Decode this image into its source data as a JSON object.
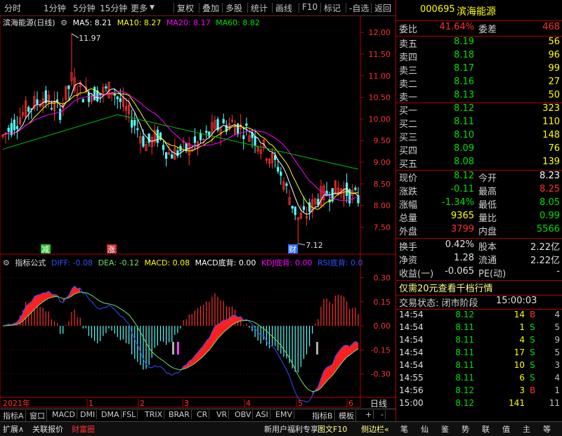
{
  "toolbar": {
    "left": [
      "分时",
      "1分钟",
      "5分钟",
      "15分钟",
      "更多"
    ],
    "right": [
      "复权",
      "叠加",
      "多股",
      "统计",
      "画线",
      "F10",
      "标记",
      "-自选",
      "返回"
    ]
  },
  "kline_header": {
    "title": "滨海能源(日线)",
    "ma5": "MA5: 8.21",
    "ma10": "MA10: 8.27",
    "ma20": "MA20: 8.17",
    "ma60": "MA60: 8.82"
  },
  "indicator_header": {
    "title": "指标公式",
    "diff": "DIFF: -0.08",
    "dea": "DEA: -0.12",
    "macd": "MACD: 0.08",
    "macd_div": "MACD底背: 0.00",
    "kdj_div": "KDJ底背: 0.00",
    "rsi_div": "RSI底背: 0.0"
  },
  "chart_labels": {
    "high_marker": "11.97",
    "low_marker": "7.12",
    "tag_jian": "减",
    "tag_zhang": "涨",
    "tag_cai": "财",
    "year_label": "2021年",
    "month_labels": [
      "1",
      "2",
      "3",
      "4",
      "5",
      "6"
    ],
    "right_bottom": "日线"
  },
  "colors": {
    "up": "#ff3030",
    "down": "#54ffff",
    "ma5": "#ffffff",
    "ma10": "#ffff00",
    "ma20": "#ff00ff",
    "ma60": "#00c000",
    "diff": "#3050ff",
    "dea": "#70e070",
    "panel_border": "#b00000"
  },
  "bottom_tabs": [
    "指标A",
    "窗口",
    "MACD",
    "DMI",
    "DMA",
    "FSL",
    "TRIX",
    "BRAR",
    "CR",
    "VR",
    "OBV",
    "ASI",
    "EMV"
  ],
  "bottom_tabs_right": [
    "指标B",
    "模板",
    "+",
    "-"
  ],
  "status_bar": {
    "left": [
      "扩展∧",
      "关联报价",
      "财富圈"
    ],
    "mid": [
      "新用户福利专享",
      "图文F10",
      "侧边栏«"
    ],
    "icons": [
      "笔",
      "仙",
      "鉴",
      "势",
      "联",
      "值",
      "主",
      "等"
    ]
  },
  "quote": {
    "code": "000695",
    "name": "滨海能源",
    "weibi_label": "委比",
    "weibi": "41.64%",
    "weicha_label": "委差",
    "weicha": "468",
    "asks": [
      {
        "label": "卖五",
        "price": "8.19",
        "vol": "56"
      },
      {
        "label": "卖四",
        "price": "8.18",
        "vol": "96"
      },
      {
        "label": "卖三",
        "price": "8.17",
        "vol": "99"
      },
      {
        "label": "卖二",
        "price": "8.16",
        "vol": "27"
      },
      {
        "label": "卖一",
        "price": "8.13",
        "vol": "50"
      }
    ],
    "bids": [
      {
        "label": "买一",
        "price": "8.12",
        "vol": "323"
      },
      {
        "label": "买二",
        "price": "8.11",
        "vol": "110"
      },
      {
        "label": "买三",
        "price": "8.10",
        "vol": "148"
      },
      {
        "label": "买四",
        "price": "8.09",
        "vol": "76"
      },
      {
        "label": "买五",
        "price": "8.08",
        "vol": "139"
      }
    ],
    "stats": [
      {
        "l1": "现价",
        "v1": "8.12",
        "c1": "#00e000",
        "l2": "今开",
        "v2": "8.23",
        "c2": "#ffffff"
      },
      {
        "l1": "涨跌",
        "v1": "-0.11",
        "c1": "#00e000",
        "l2": "最高",
        "v2": "8.25",
        "c2": "#ff3030"
      },
      {
        "l1": "涨幅",
        "v1": "-1.34%",
        "c1": "#00e000",
        "l2": "最低",
        "v2": "8.05",
        "c2": "#00e000"
      },
      {
        "l1": "总量",
        "v1": "9365",
        "c1": "#ffff00",
        "l2": "量比",
        "v2": "0.99",
        "c2": "#00e000"
      },
      {
        "l1": "外盘",
        "v1": "3799",
        "c1": "#ff3030",
        "l2": "内盘",
        "v2": "5566",
        "c2": "#00e000"
      }
    ],
    "fin": [
      {
        "l1": "换手",
        "v1": "0.42%",
        "l2": "股本",
        "v2": "2.22亿"
      },
      {
        "l1": "净资",
        "v1": "1.28",
        "l2": "流通",
        "v2": "2.22亿"
      },
      {
        "l1": "收益(一)",
        "v1": "-0.065",
        "l2": "PE(动)",
        "v2": "-"
      }
    ],
    "promo": "仅需20元查看千档行情",
    "trade_status_label": "交易状态: 闭市阶段",
    "trade_status_time": "15:00:03",
    "ticks": [
      {
        "time": "14:54",
        "price": "8.12",
        "vol": "14",
        "side": "B"
      },
      {
        "time": "14:54",
        "price": "8.11",
        "vol": "1",
        "side": "S"
      },
      {
        "time": "14:54",
        "price": "8.11",
        "vol": "4",
        "side": "S"
      },
      {
        "time": "14:54",
        "price": "8.11",
        "vol": "17",
        "side": "S"
      },
      {
        "time": "14:54",
        "price": "8.11",
        "vol": "10",
        "side": "S"
      },
      {
        "time": "14:55",
        "price": "8.11",
        "vol": "6",
        "side": "S"
      },
      {
        "time": "14:56",
        "price": "8.12",
        "vol": "3",
        "side": "B"
      },
      {
        "time": "15:00",
        "price": "8.12",
        "vol": "141",
        "side": ""
      }
    ],
    "tick_extra": [
      "4",
      "5",
      "9",
      "5",
      "3",
      "4",
      "1",
      "11"
    ]
  },
  "chart_data": [
    {
      "type": "candlestick",
      "title": "滨海能源(日线)",
      "ylim": [
        7.2,
        12.1
      ],
      "y_ticks": [
        7.5,
        8.0,
        8.5,
        9.0,
        9.5,
        10.0,
        10.5,
        11.0,
        11.5,
        12.0
      ],
      "x_labels": [
        "2021年",
        "1",
        "2",
        "3",
        "4",
        "5",
        "6"
      ],
      "high": 11.97,
      "low": 7.12,
      "series_ma": {
        "MA5": 8.21,
        "MA10": 8.27,
        "MA20": 8.17,
        "MA60": 8.82
      }
    },
    {
      "type": "bar",
      "title": "指标公式",
      "ylim": [
        -0.45,
        0.35
      ],
      "y_ticks": [
        0.3,
        0.15,
        0.0,
        -0.15,
        -0.3
      ],
      "series_values": {
        "DIFF": -0.08,
        "DEA": -0.12,
        "MACD": 0.08
      }
    }
  ]
}
